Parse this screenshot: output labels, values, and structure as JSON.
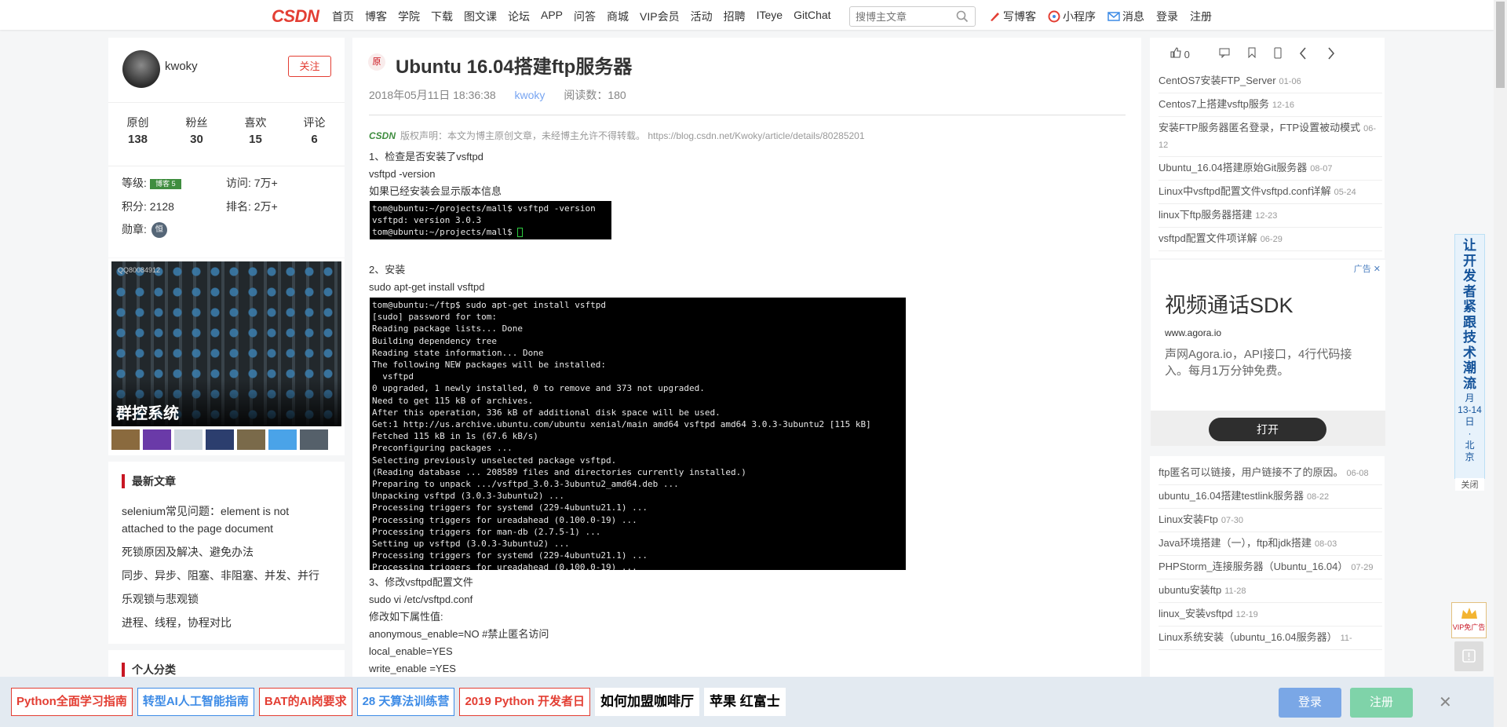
{
  "nav": {
    "logo": "CSDN",
    "links": [
      "首页",
      "博客",
      "学院",
      "下载",
      "图文课",
      "论坛",
      "APP",
      "问答",
      "商城",
      "VIP会员",
      "活动",
      "招聘",
      "ITeye",
      "GitChat"
    ],
    "search_placeholder": "搜博主文章",
    "right": [
      "写博客",
      "小程序",
      "消息",
      "登录",
      "注册"
    ]
  },
  "profile": {
    "name": "kwoky",
    "follow": "关注",
    "stats": [
      {
        "label": "原创",
        "value": "138"
      },
      {
        "label": "粉丝",
        "value": "30"
      },
      {
        "label": "喜欢",
        "value": "15"
      },
      {
        "label": "评论",
        "value": "6"
      }
    ],
    "level_label": "等级:",
    "level_badge": "博客 5",
    "visits_label": "访问:",
    "visits": "7万+",
    "points_label": "积分:",
    "points": "2128",
    "rank_label": "排名:",
    "rank": "2万+",
    "medal_label": "勋章:",
    "medal": "恒"
  },
  "left_ad": {
    "caption": "群控系统",
    "qq": "QQ80084912"
  },
  "recent": {
    "title": "最新文章",
    "items": [
      "selenium常见问题：element is not attached to the page document",
      "死锁原因及解决、避免办法",
      "同步、异步、阻塞、非阻塞、并发、并行",
      "乐观锁与悲观锁",
      "进程、线程，协程对比"
    ]
  },
  "categories": {
    "title": "个人分类"
  },
  "article": {
    "badge": "原",
    "title": "Ubuntu 16.04搭建ftp服务器",
    "date": "2018年05月11日 18:36:38",
    "author": "kwoky",
    "reads": "阅读数：180",
    "copyright_logo": "CSDN",
    "copyright": "版权声明：本文为博主原创文章，未经博主允许不得转载。 https://blog.csdn.net/Kwoky/article/details/80285201",
    "p1": [
      "1、检查是否安装了vsftpd",
      "vsftpd -version",
      "如果已经安装会显示版本信息"
    ],
    "term1": [
      "tom@ubuntu:~/projects/mall$ vsftpd -version",
      "vsftpd: version 3.0.3",
      "tom@ubuntu:~/projects/mall$ "
    ],
    "p2": [
      "2、安装",
      "sudo apt-get install vsftpd"
    ],
    "term2": [
      "tom@ubuntu:~/ftp$ sudo apt-get install vsftpd",
      "[sudo] password for tom:",
      "Reading package lists... Done",
      "Building dependency tree",
      "Reading state information... Done",
      "The following NEW packages will be installed:",
      "  vsftpd",
      "0 upgraded, 1 newly installed, 0 to remove and 373 not upgraded.",
      "Need to get 115 kB of archives.",
      "After this operation, 336 kB of additional disk space will be used.",
      "Get:1 http://us.archive.ubuntu.com/ubuntu xenial/main amd64 vsftpd amd64 3.0.3-3ubuntu2 [115 kB]",
      "Fetched 115 kB in 1s (67.6 kB/s)",
      "Preconfiguring packages ...",
      "Selecting previously unselected package vsftpd.",
      "(Reading database ... 208589 files and directories currently installed.)",
      "Preparing to unpack .../vsftpd_3.0.3-3ubuntu2_amd64.deb ...",
      "Unpacking vsftpd (3.0.3-3ubuntu2) ...",
      "Processing triggers for systemd (229-4ubuntu21.1) ...",
      "Processing triggers for ureadahead (0.100.0-19) ...",
      "Processing triggers for man-db (2.7.5-1) ...",
      "Setting up vsftpd (3.0.3-3ubuntu2) ...",
      "Processing triggers for systemd (229-4ubuntu21.1) ...",
      "Processing triggers for ureadahead (0.100.0-19) ..."
    ],
    "p3": [
      "3、修改vsftpd配置文件",
      "sudo vi /etc/vsftpd.conf",
      "修改如下属性值:",
      "anonymous_enable=NO #禁止匿名访问",
      "local_enable=YES",
      "write_enable =YES"
    ]
  },
  "right_tool": {
    "likes": "0"
  },
  "right_links_top": [
    {
      "title": "CentOS7安装FTP_Server",
      "date": "01-06"
    },
    {
      "title": "Centos7上搭建vsftp服务",
      "date": "12-16"
    },
    {
      "title": "安装FTP服务器匿名登录，FTP设置被动模式",
      "date": "06-12"
    },
    {
      "title": "Ubuntu_16.04搭建原始Git服务器",
      "date": "08-07"
    },
    {
      "title": "Linux中vsftpd配置文件vsftpd.conf详解",
      "date": "05-24"
    },
    {
      "title": "linux下ftp服务器搭建",
      "date": "12-23"
    },
    {
      "title": "vsftpd配置文件项详解",
      "date": "06-29"
    }
  ],
  "right_ad": {
    "label": "广告",
    "heading": "视频通话SDK",
    "url": "www.agora.io",
    "desc": "声网Agora.io，API接口，4行代码接入。每月1万分钟免费。",
    "button": "打开"
  },
  "right_links_bottom": [
    {
      "title": "ftp匿名可以链接，用户链接不了的原因。",
      "date": "06-08"
    },
    {
      "title": "ubuntu_16.04搭建testlink服务器",
      "date": "08-22"
    },
    {
      "title": "Linux安装Ftp",
      "date": "07-30"
    },
    {
      "title": "Java环境搭建（一），ftp和jdk搭建",
      "date": "08-03"
    },
    {
      "title": "PHPStorm_连接服务器（Ubuntu_16.04）",
      "date": "07-29"
    },
    {
      "title": "ubuntu安装ftp",
      "date": "11-28"
    },
    {
      "title": "linux_安装vsftpd",
      "date": "12-19"
    },
    {
      "title": "Linux系统安装（ubuntu_16.04服务器）",
      "date": "11-"
    }
  ],
  "vbanner": {
    "text": "让开发者紧跟技术潮流",
    "date": "4月13-14日·北京",
    "close": "关闭"
  },
  "vip": {
    "label": "VIP免广告"
  },
  "bottom": {
    "tags": [
      {
        "text": "Python全面学习指南",
        "style": "red"
      },
      {
        "text": "转型AI人工智能指南",
        "style": "blue"
      },
      {
        "text": "BAT的AI岗要求",
        "style": "red"
      },
      {
        "text": "28 天算法训练营",
        "style": "blue"
      },
      {
        "text": "2019 Python 开发者日",
        "style": "red"
      },
      {
        "text": "如何加盟咖啡厅",
        "style": "plain"
      },
      {
        "text": "苹果 红富士",
        "style": "plain"
      }
    ],
    "login": "登录",
    "register": "注册"
  }
}
